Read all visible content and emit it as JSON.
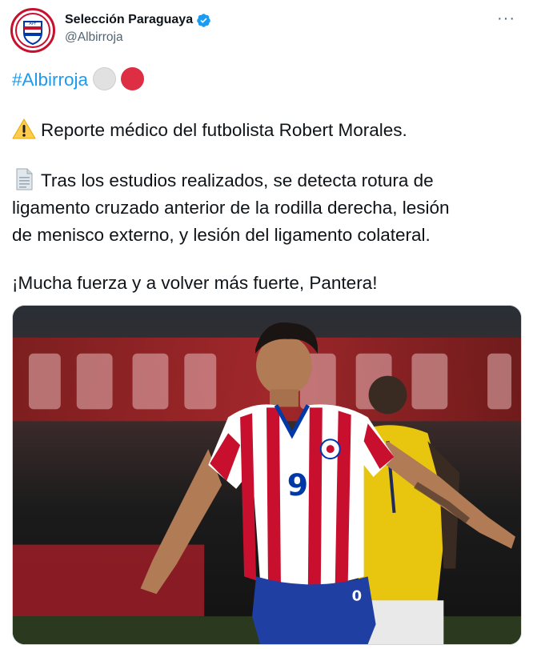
{
  "account": {
    "display_name": "Selección Paraguaya",
    "handle": "@Albirroja",
    "avatar": "apf-crest-icon",
    "verified": true
  },
  "menu_icon": "more-options-icon",
  "tweet": {
    "hashtag": "#Albirroja",
    "circle_emojis": [
      "white-circle-icon",
      "red-circle-icon"
    ],
    "line_warning": "Reporte médico del futbolista Robert Morales.",
    "line_report_1": "Tras los estudios realizados, se detecta rotura de",
    "line_report_2": "ligamento cruzado anterior de la rodilla derecha, lesión",
    "line_report_3": "de menisco externo, y lesión del ligamento colateral.",
    "line_closing": "¡Mucha fuerza y a volver más fuerte, Pantera!"
  },
  "media": {
    "jersey_number": "9",
    "type": "photo"
  },
  "colors": {
    "link": "#1d9bf0",
    "secondary_text": "#536471",
    "paraguay_red": "#c8102e",
    "paraguay_blue": "#0038a8"
  }
}
